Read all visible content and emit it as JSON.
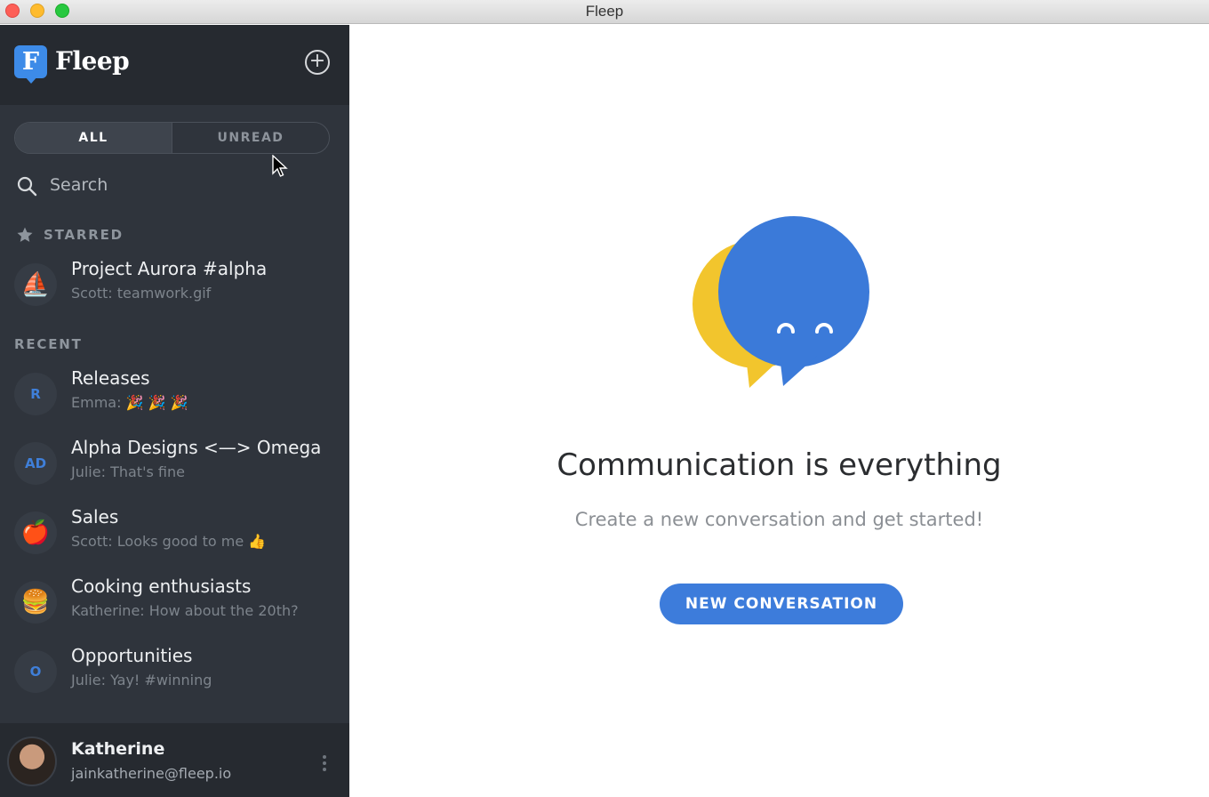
{
  "window": {
    "title": "Fleep"
  },
  "sidebar": {
    "brand": {
      "logo_letter": "F",
      "name": "Fleep"
    },
    "add_label": "+",
    "filter_tabs": [
      {
        "label": "ALL",
        "active": true
      },
      {
        "label": "UNREAD",
        "active": false
      }
    ],
    "search": {
      "label": "Search"
    },
    "starred": {
      "title": "STARRED",
      "items": [
        {
          "name": "Project Aurora #alpha",
          "preview": "Scott: teamwork.gif",
          "avatar": "⛵"
        }
      ]
    },
    "recent": {
      "title": "RECENT",
      "items": [
        {
          "name": "Releases",
          "preview": "Emma: 🎉 🎉 🎉",
          "avatar": "R"
        },
        {
          "name": "Alpha Designs <—> Omega",
          "preview": "Julie: That's fine",
          "avatar": "AD"
        },
        {
          "name": "Sales",
          "preview": "Scott: Looks good to me 👍",
          "avatar": "🍎"
        },
        {
          "name": "Cooking enthusiasts",
          "preview": "Katherine: How about the 20th?",
          "avatar": "🍔"
        },
        {
          "name": "Opportunities",
          "preview": "Julie: Yay! #winning",
          "avatar": "O"
        }
      ]
    },
    "user": {
      "name": "Katherine",
      "email": "jainkatherine@fleep.io"
    }
  },
  "main": {
    "headline": "Communication is everything",
    "subline": "Create a new conversation and get started!",
    "cta_label": "NEW CONVERSATION"
  },
  "colors": {
    "sidebar_bg": "#2f343c",
    "brand_blue": "#3d8be8",
    "cta_blue": "#3d7cdb",
    "bubble_yellow": "#f2c52d",
    "bubble_blue": "#3b7ad9"
  }
}
